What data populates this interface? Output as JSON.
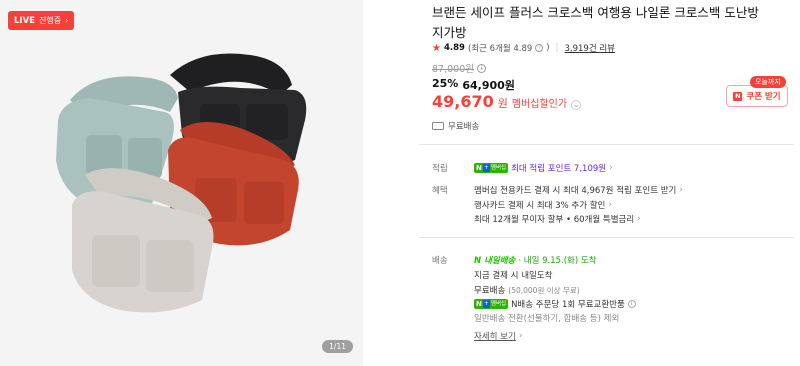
{
  "gallery": {
    "live_badge": {
      "live": "LIVE",
      "label": "진행중",
      "chevron": "›"
    },
    "counter": "1/11",
    "image_alt": "product-photo-crossbody-bags",
    "bag_colors": [
      "#a9c2be",
      "#2a2a2c",
      "#c4452e",
      "#d7d4cf"
    ]
  },
  "product": {
    "title": "브랜든 세이프 플러스 크로스백 여행용 나일론 크로스백 도난방지가방",
    "rating": {
      "star": "★",
      "score": "4.89",
      "recent": "(최근 6개월 4.89",
      "recent_close": ")",
      "help_icon": "?",
      "sep": "|",
      "reviews": "3,919건 리뷰"
    },
    "price": {
      "original": "87,000원",
      "original_info_icon": "i",
      "discount_pct": "25%",
      "discount_price": "64,900원",
      "member_amount": "49,670",
      "member_unit": "원",
      "member_label": "멤버십할인가",
      "member_chevron": "⌄"
    },
    "coupon": {
      "tag": "오늘까지",
      "icon": "N",
      "label": "쿠폰 받기"
    },
    "delivery_tag": "무료배송"
  },
  "benefits": {
    "accrual": {
      "label": "적립",
      "badge": {
        "n": "N",
        "plus": "+",
        "m": "멤버십"
      },
      "text": "최대 적립 포인트 7,109원",
      "chevron": "›"
    },
    "perks": {
      "label": "혜택",
      "items": [
        "멤버십 전용카드 결제 시 최대 4,967원 적립 포인트 받기",
        "행사카드 결제 시 최대 3% 추가 할인",
        "최대 12개월 무이자 할부 • 60개월 특별금리"
      ],
      "chevron": "›"
    }
  },
  "shipping": {
    "label": "배송",
    "badge": "N 내일배송",
    "date": "· 내일 9.15.(화) 도착",
    "lines": {
      "pay_today": "지금 결제 시 내일도착",
      "free": "무료배송",
      "free_cond": "(50,000원 이상 무료)",
      "npay_badge": {
        "n": "N",
        "plus": "+",
        "m": "멤버십"
      },
      "exchange": "N배송 주문당 1회 무료교환반품",
      "exchange_icon": "i",
      "excluded": "일반배송 전환(선물하기, 합배송 등) 제외",
      "more": "자세히 보기",
      "more_chevron": "›"
    }
  },
  "colors": {
    "accent": "#f5413a",
    "naver_green": "#1ec800",
    "member_purple": "#6a2ad6"
  }
}
